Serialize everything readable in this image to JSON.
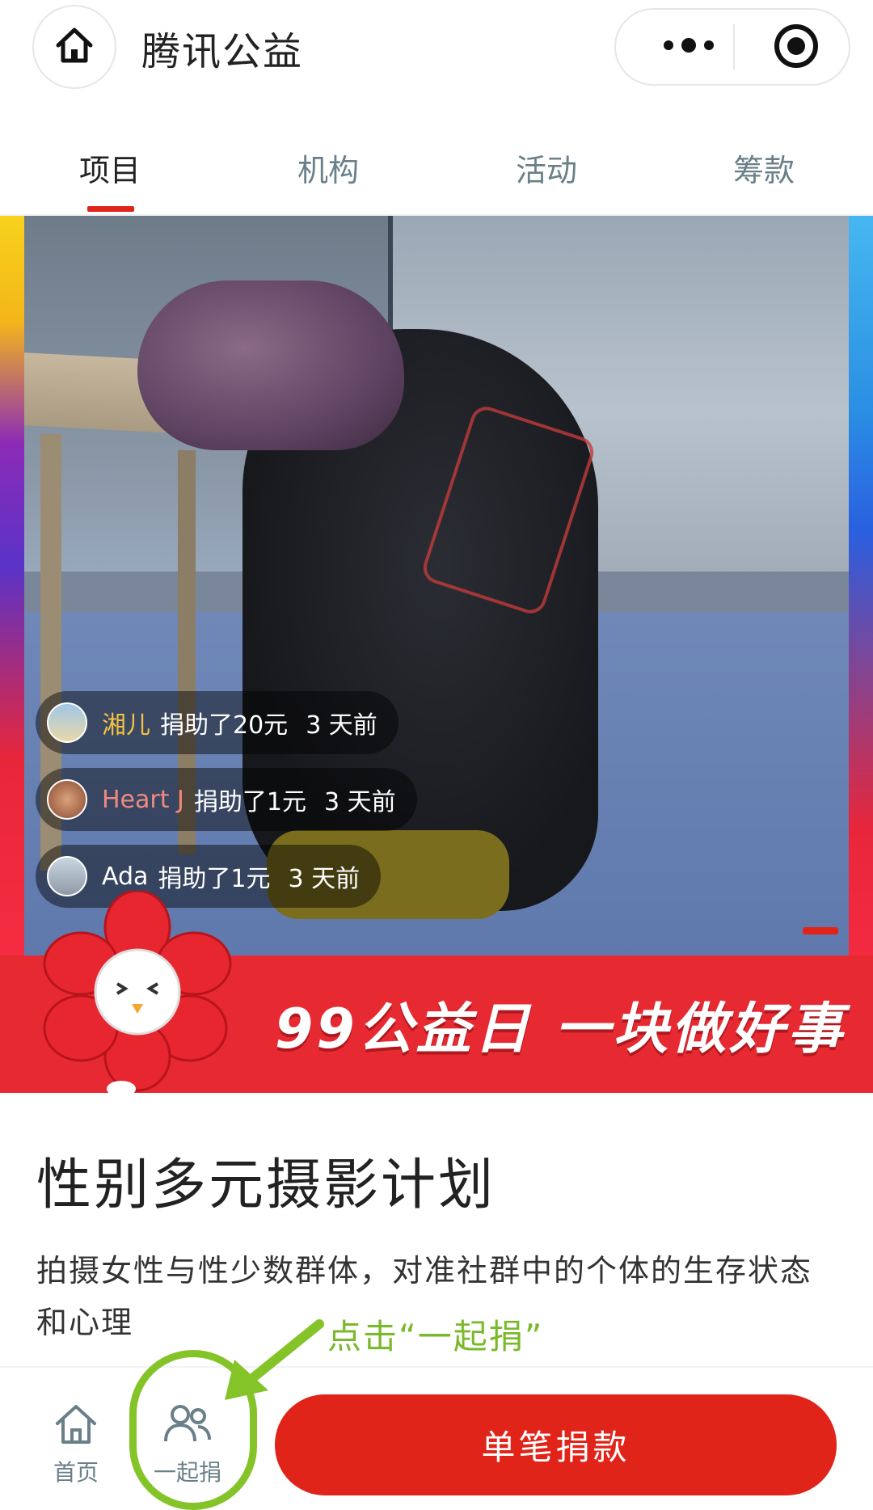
{
  "header": {
    "app_title": "腾讯公益",
    "home_icon": "home-icon",
    "more_icon": "more-dots-icon",
    "target_icon": "record-target-icon"
  },
  "tabs": [
    {
      "label": "项目",
      "active": true
    },
    {
      "label": "机构",
      "active": false
    },
    {
      "label": "活动",
      "active": false
    },
    {
      "label": "筹款",
      "active": false
    }
  ],
  "banner": {
    "donation_feed": [
      {
        "name": "湘儿",
        "action": "捐助了20元",
        "time": "3 天前",
        "name_color": "#f5c242"
      },
      {
        "name": "Heart J",
        "action": "捐助了1元",
        "time": "3 天前",
        "name_color": "#f08a80"
      },
      {
        "name": "Ada",
        "action": "捐助了1元",
        "time": "3 天前",
        "name_color": "#ffffff"
      }
    ],
    "promo_text": "99公益日 一块做好事"
  },
  "project": {
    "title": "性别多元摄影计划",
    "description": "拍摄女性与性少数群体，对准社群中的个体的生存状态和心理"
  },
  "annotation": {
    "hint": "点击“一起捐”"
  },
  "bottom_bar": {
    "home_label": "首页",
    "together_label": "一起捐",
    "donate_button": "单笔捐款"
  },
  "colors": {
    "accent": "#e0241a",
    "tab_inactive": "#6a7f88",
    "annotation_green": "#84c429"
  }
}
